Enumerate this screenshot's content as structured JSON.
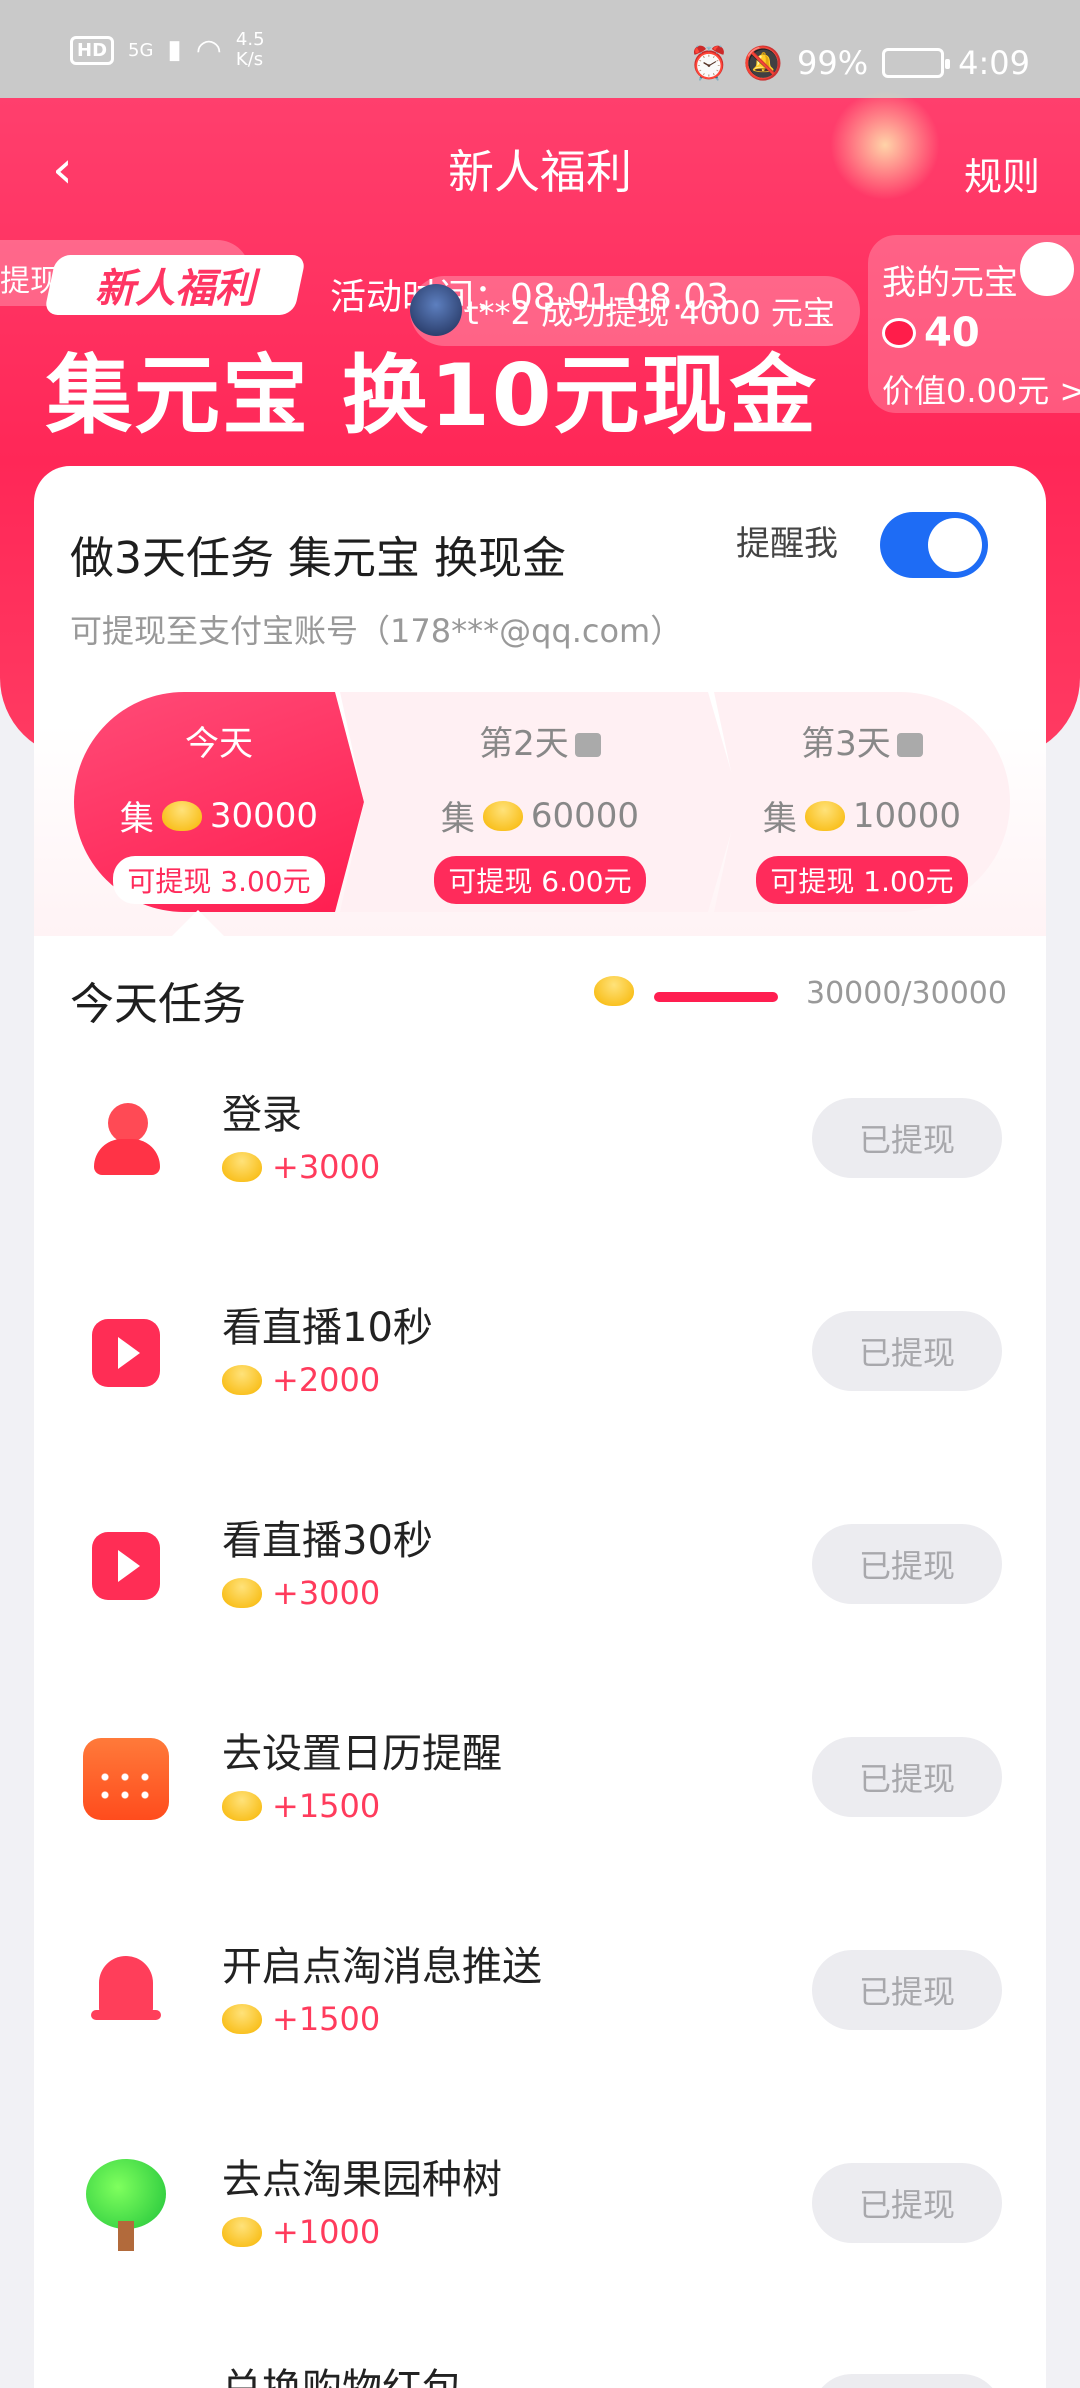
{
  "status_bar": {
    "hd": "HD",
    "network": "5G",
    "speed": "4.5\nK/s",
    "battery": "99%",
    "time": "4:09"
  },
  "nav": {
    "back": "‹",
    "title": "新人福利",
    "rules": "规则"
  },
  "hero": {
    "ticker_left": "提现",
    "badge": "新人福利",
    "activity_time": "活动时间：08.01-08.03",
    "toast": "t**2 成功提现 4000 元宝",
    "headline": "集元宝 换10元现金",
    "balance": {
      "label": "我的元宝",
      "amount": "40",
      "value": "价值0.00元 >"
    }
  },
  "card": {
    "title": "做3天任务 集元宝 换现金",
    "remind_label": "提醒我",
    "remind_on": true,
    "account": "可提现至支付宝账号（178***@qq.com）",
    "days": [
      {
        "name": "今天",
        "collect_prefix": "集",
        "coins": "30000",
        "cash": "可提现 3.00元",
        "locked": false
      },
      {
        "name": "第2天",
        "collect_prefix": "集",
        "coins": "60000",
        "cash": "可提现 6.00元",
        "locked": true
      },
      {
        "name": "第3天",
        "collect_prefix": "集",
        "coins": "10000",
        "cash": "可提现 1.00元",
        "locked": true
      }
    ]
  },
  "tasks": {
    "title": "今天任务",
    "progress": "30000/30000",
    "progress_fraction": 1.0,
    "items": [
      {
        "name": "登录",
        "reward": "+3000",
        "button": "已提现",
        "icon": "user-icon"
      },
      {
        "name": "看直播10秒",
        "reward": "+2000",
        "button": "已提现",
        "icon": "play-icon"
      },
      {
        "name": "看直播30秒",
        "reward": "+3000",
        "button": "已提现",
        "icon": "play-icon"
      },
      {
        "name": "去设置日历提醒",
        "reward": "+1500",
        "button": "已提现",
        "icon": "calendar-icon"
      },
      {
        "name": "开启点淘消息推送",
        "reward": "+1500",
        "button": "已提现",
        "icon": "bell-icon"
      },
      {
        "name": "去点淘果园种树",
        "reward": "+1000",
        "button": "已提现",
        "icon": "tree-icon"
      },
      {
        "name": "兑换购物红包",
        "reward": "",
        "button": "",
        "icon": "red-packet-icon"
      }
    ]
  },
  "colors": {
    "brand": "#ff2757",
    "toggle": "#1e6cf5",
    "reward": "#ff3b5c",
    "disabled_button": "#ececf0"
  }
}
